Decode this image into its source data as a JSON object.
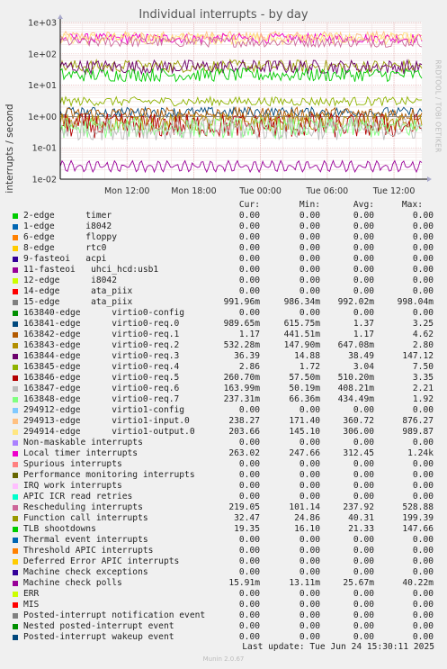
{
  "title": "Individual interrupts - by day",
  "ylabel": "interrupts / second",
  "side_label": "RRDTOOL / TOBI OETIKER",
  "footer": "Munin 2.0.67",
  "last_update": "Last update: Tue Jun 24 15:30:11 2025",
  "legend_headers": {
    "cur": "Cur:",
    "min": "Min:",
    "avg": "Avg:",
    "max": "Max:"
  },
  "chart_data": {
    "type": "line",
    "title": "Individual interrupts - by day",
    "xlabel": "",
    "ylabel": "interrupts / second",
    "y_scale": "log",
    "ylim": [
      0.01,
      1000
    ],
    "y_ticks": [
      {
        "value": 1000,
        "label": "1e+03"
      },
      {
        "value": 100,
        "label": "1e+02"
      },
      {
        "value": 10,
        "label": "1e+01"
      },
      {
        "value": 1,
        "label": "1e+00"
      },
      {
        "value": 0.1,
        "label": "1e-01"
      },
      {
        "value": 0.01,
        "label": "1e-02"
      }
    ],
    "x_range_hours": [
      6,
      36
    ],
    "x_ticks": [
      {
        "hour": 12,
        "label": "Mon 12:00"
      },
      {
        "hour": 18,
        "label": "Mon 18:00"
      },
      {
        "hour": 24,
        "label": "Tue 00:00"
      },
      {
        "hour": 30,
        "label": "Tue 06:00"
      },
      {
        "hour": 36,
        "label": "Tue 12:00"
      }
    ],
    "grid": true,
    "series": [
      {
        "name": "2-edge      timer",
        "color": "#00cc00",
        "cur": "0.00",
        "min": "0.00",
        "avg": "0.00",
        "max": "0.00"
      },
      {
        "name": "1-edge      i8042",
        "color": "#0066b3",
        "cur": "0.00",
        "min": "0.00",
        "avg": "0.00",
        "max": "0.00"
      },
      {
        "name": "6-edge      floppy",
        "color": "#ff8000",
        "cur": "0.00",
        "min": "0.00",
        "avg": "0.00",
        "max": "0.00"
      },
      {
        "name": "8-edge      rtc0",
        "color": "#ffcc00",
        "cur": "0.00",
        "min": "0.00",
        "avg": "0.00",
        "max": "0.00"
      },
      {
        "name": "9-fasteoi   acpi",
        "color": "#330099",
        "cur": "0.00",
        "min": "0.00",
        "avg": "0.00",
        "max": "0.00"
      },
      {
        "name": "11-fasteoi   uhci_hcd:usb1",
        "color": "#990099",
        "cur": "0.00",
        "min": "0.00",
        "avg": "0.00",
        "max": "0.00"
      },
      {
        "name": "12-edge      i8042",
        "color": "#ccff00",
        "cur": "0.00",
        "min": "0.00",
        "avg": "0.00",
        "max": "0.00"
      },
      {
        "name": "14-edge      ata_piix",
        "color": "#ff0000",
        "cur": "0.00",
        "min": "0.00",
        "avg": "0.00",
        "max": "0.00"
      },
      {
        "name": "15-edge      ata_piix",
        "color": "#808080",
        "cur": "991.96m",
        "min": "986.34m",
        "avg": "992.02m",
        "max": "998.04m"
      },
      {
        "name": "163840-edge      virtio0-config",
        "color": "#008f00",
        "cur": "0.00",
        "min": "0.00",
        "avg": "0.00",
        "max": "0.00"
      },
      {
        "name": "163841-edge      virtio0-req.0",
        "color": "#00487d",
        "cur": "989.65m",
        "min": "615.75m",
        "avg": "1.37",
        "max": "3.25"
      },
      {
        "name": "163842-edge      virtio0-req.1",
        "color": "#b35a00",
        "cur": "1.17",
        "min": "441.51m",
        "avg": "1.17",
        "max": "4.62"
      },
      {
        "name": "163843-edge      virtio0-req.2",
        "color": "#b38f00",
        "cur": "532.28m",
        "min": "147.90m",
        "avg": "647.08m",
        "max": "2.80"
      },
      {
        "name": "163844-edge      virtio0-req.3",
        "color": "#6b006b",
        "cur": "36.39",
        "min": "14.88",
        "avg": "38.49",
        "max": "147.12"
      },
      {
        "name": "163845-edge      virtio0-req.4",
        "color": "#8fb300",
        "cur": "2.86",
        "min": "1.72",
        "avg": "3.04",
        "max": "7.50"
      },
      {
        "name": "163846-edge      virtio0-req.5",
        "color": "#b30000",
        "cur": "260.70m",
        "min": "57.50m",
        "avg": "510.20m",
        "max": "3.35"
      },
      {
        "name": "163847-edge      virtio0-req.6",
        "color": "#bebebe",
        "cur": "163.99m",
        "min": "50.19m",
        "avg": "408.21m",
        "max": "2.21"
      },
      {
        "name": "163848-edge      virtio0-req.7",
        "color": "#80ff80",
        "cur": "237.31m",
        "min": "66.36m",
        "avg": "434.49m",
        "max": "1.92"
      },
      {
        "name": "294912-edge      virtio1-config",
        "color": "#80c9ff",
        "cur": "0.00",
        "min": "0.00",
        "avg": "0.00",
        "max": "0.00"
      },
      {
        "name": "294913-edge      virtio1-input.0",
        "color": "#ffc080",
        "cur": "238.27",
        "min": "171.40",
        "avg": "360.72",
        "max": "876.27"
      },
      {
        "name": "294914-edge      virtio1-output.0",
        "color": "#ffe680",
        "cur": "203.66",
        "min": "145.10",
        "avg": "306.00",
        "max": "989.87"
      },
      {
        "name": "Non-maskable interrupts",
        "color": "#aa80ff",
        "cur": "0.00",
        "min": "0.00",
        "avg": "0.00",
        "max": "0.00"
      },
      {
        "name": "Local timer interrupts",
        "color": "#ee00cc",
        "cur": "263.02",
        "min": "247.66",
        "avg": "312.45",
        "max": "1.24k"
      },
      {
        "name": "Spurious interrupts",
        "color": "#ff8080",
        "cur": "0.00",
        "min": "0.00",
        "avg": "0.00",
        "max": "0.00"
      },
      {
        "name": "Performance monitoring interrupts",
        "color": "#666600",
        "cur": "0.00",
        "min": "0.00",
        "avg": "0.00",
        "max": "0.00"
      },
      {
        "name": "IRQ work interrupts",
        "color": "#ffbfff",
        "cur": "0.00",
        "min": "0.00",
        "avg": "0.00",
        "max": "0.00"
      },
      {
        "name": "APIC ICR read retries",
        "color": "#00ffcc",
        "cur": "0.00",
        "min": "0.00",
        "avg": "0.00",
        "max": "0.00"
      },
      {
        "name": "Rescheduling interrupts",
        "color": "#cc6699",
        "cur": "219.05",
        "min": "101.14",
        "avg": "237.92",
        "max": "528.88"
      },
      {
        "name": "Function call interrupts",
        "color": "#999900",
        "cur": "32.47",
        "min": "24.86",
        "avg": "40.31",
        "max": "199.39"
      },
      {
        "name": "TLB shootdowns",
        "color": "#00cc00",
        "cur": "19.35",
        "min": "16.10",
        "avg": "21.33",
        "max": "147.66"
      },
      {
        "name": "Thermal event interrupts",
        "color": "#0066b3",
        "cur": "0.00",
        "min": "0.00",
        "avg": "0.00",
        "max": "0.00"
      },
      {
        "name": "Threshold APIC interrupts",
        "color": "#ff8000",
        "cur": "0.00",
        "min": "0.00",
        "avg": "0.00",
        "max": "0.00"
      },
      {
        "name": "Deferred Error APIC interrupts",
        "color": "#ffcc00",
        "cur": "0.00",
        "min": "0.00",
        "avg": "0.00",
        "max": "0.00"
      },
      {
        "name": "Machine check exceptions",
        "color": "#330099",
        "cur": "0.00",
        "min": "0.00",
        "avg": "0.00",
        "max": "0.00"
      },
      {
        "name": "Machine check polls",
        "color": "#990099",
        "cur": "15.91m",
        "min": "13.11m",
        "avg": "25.67m",
        "max": "40.22m"
      },
      {
        "name": "ERR",
        "color": "#ccff00",
        "cur": "0.00",
        "min": "0.00",
        "avg": "0.00",
        "max": "0.00"
      },
      {
        "name": "MIS",
        "color": "#ff0000",
        "cur": "0.00",
        "min": "0.00",
        "avg": "0.00",
        "max": "0.00"
      },
      {
        "name": "Posted-interrupt notification event",
        "color": "#808080",
        "cur": "0.00",
        "min": "0.00",
        "avg": "0.00",
        "max": "0.00"
      },
      {
        "name": "Nested posted-interrupt event",
        "color": "#008f00",
        "cur": "0.00",
        "min": "0.00",
        "avg": "0.00",
        "max": "0.00"
      },
      {
        "name": "Posted-interrupt wakeup event",
        "color": "#00487d",
        "cur": "0.00",
        "min": "0.00",
        "avg": "0.00",
        "max": "0.00"
      }
    ]
  }
}
